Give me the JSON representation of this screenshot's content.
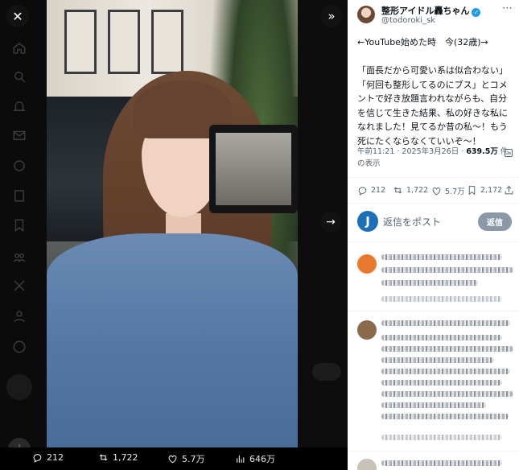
{
  "viewer": {
    "close_icon": "close-icon",
    "collapse_icon": "chevron-double-right-icon",
    "next_icon": "arrow-right-icon"
  },
  "media_actions": {
    "replies": "212",
    "reposts": "1,722",
    "likes": "5.7万",
    "views": "646万"
  },
  "tweet": {
    "display_name": "整形アイドル轟ちゃん",
    "verified": "✓",
    "handle": "@todoroki_sk",
    "text": "←YouTube始めた時　今(32歳)→\n\n「面長だから可愛い系は似合わない」「何回も整形してるのにブス」とコメントで好き放題言われながらも、自分を信じて生きた結果、私の好きな私になれました！見てるか昔の私〜！もう死にたくならなくていいぞ〜！",
    "time": "午前11:21 · 2025年3月26日 · ",
    "views_count": "639.5万",
    "views_suffix": " 件",
    "views_label": "の表示",
    "actions": {
      "replies": "212",
      "reposts": "1,722",
      "likes": "5.7万",
      "bookmarks": "2,172"
    }
  },
  "reply_box": {
    "avatar_letter": "J",
    "placeholder": "返信をポスト",
    "button": "返信"
  },
  "colors": {
    "accent": "#1d9bf0",
    "reply_button": "#8b98a5",
    "reply_avatar": "#1d6fb8"
  }
}
